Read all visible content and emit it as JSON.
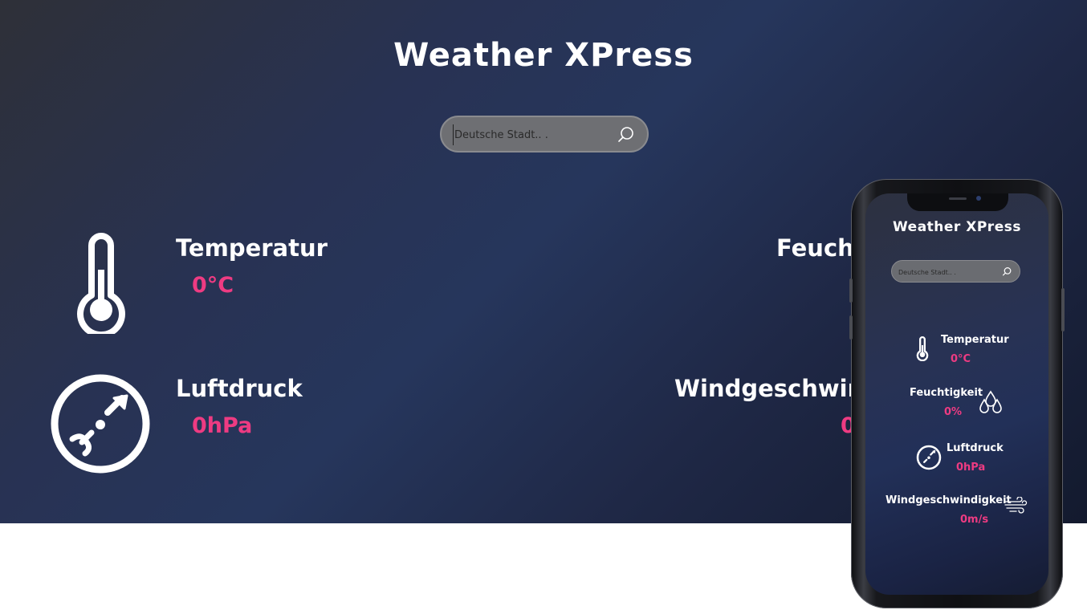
{
  "app": {
    "title": "Weather XPress"
  },
  "search": {
    "placeholder": "Deutsche Stadt.. .",
    "icon": "search-icon"
  },
  "stats": {
    "temperature": {
      "label": "Temperatur",
      "value": "0°C",
      "icon": "thermometer-icon"
    },
    "humidity": {
      "label": "Feuchtigkeit",
      "value": "0%",
      "icon": "water-drops-icon"
    },
    "pressure": {
      "label": "Luftdruck",
      "value": "0hPa",
      "icon": "pressure-gauge-icon"
    },
    "wind": {
      "label": "Windgeschwindigkeit",
      "value": "0m/s",
      "icon": "wind-icon"
    }
  },
  "colors": {
    "accent": "#ee3b82",
    "background_dark": "#26365c",
    "text": "#ffffff"
  }
}
